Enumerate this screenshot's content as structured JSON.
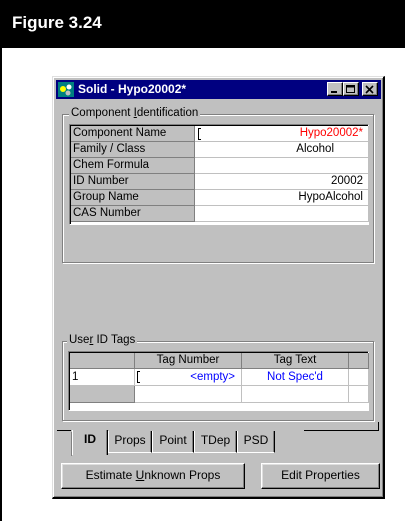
{
  "figure": {
    "title": "Figure 3.24"
  },
  "window": {
    "title": "Solid - Hypo20002*",
    "icon": "solid-app-icon",
    "controls": [
      "minimize-icon",
      "maximize-icon",
      "close-icon"
    ]
  },
  "component_identification": {
    "label_before": "Component ",
    "label_accel": "I",
    "label_after": "dentification",
    "rows": [
      {
        "label": "Component Name",
        "value": "Hypo20002*"
      },
      {
        "label": "Family / Class",
        "value": "Alcohol"
      },
      {
        "label": "Chem Formula",
        "value": ""
      },
      {
        "label": "ID Number",
        "value": "20002"
      },
      {
        "label": "Group Name",
        "value": "HypoAlcohol"
      },
      {
        "label": "CAS Number",
        "value": ""
      }
    ]
  },
  "user_id_tags": {
    "label_before": "Use",
    "label_accel": "r",
    "label_after": " ID Tags",
    "headers": [
      "Tag Number",
      "Tag Text"
    ],
    "rows": [
      {
        "index": "1",
        "tag_number": "<empty>",
        "tag_text": "Not Spec'd"
      }
    ]
  },
  "tabs": [
    "ID",
    "Props",
    "Point",
    "TDep",
    "PSD"
  ],
  "buttons": {
    "estimate_before": "Estimate ",
    "estimate_accel": "U",
    "estimate_after": "nknown Props",
    "edit_properties": "Edit Properties"
  },
  "colors": {
    "titlebar": "#000080",
    "highlight_value": "#ff0000",
    "tag_value": "#0000ff",
    "face": "#c0c0c0"
  }
}
